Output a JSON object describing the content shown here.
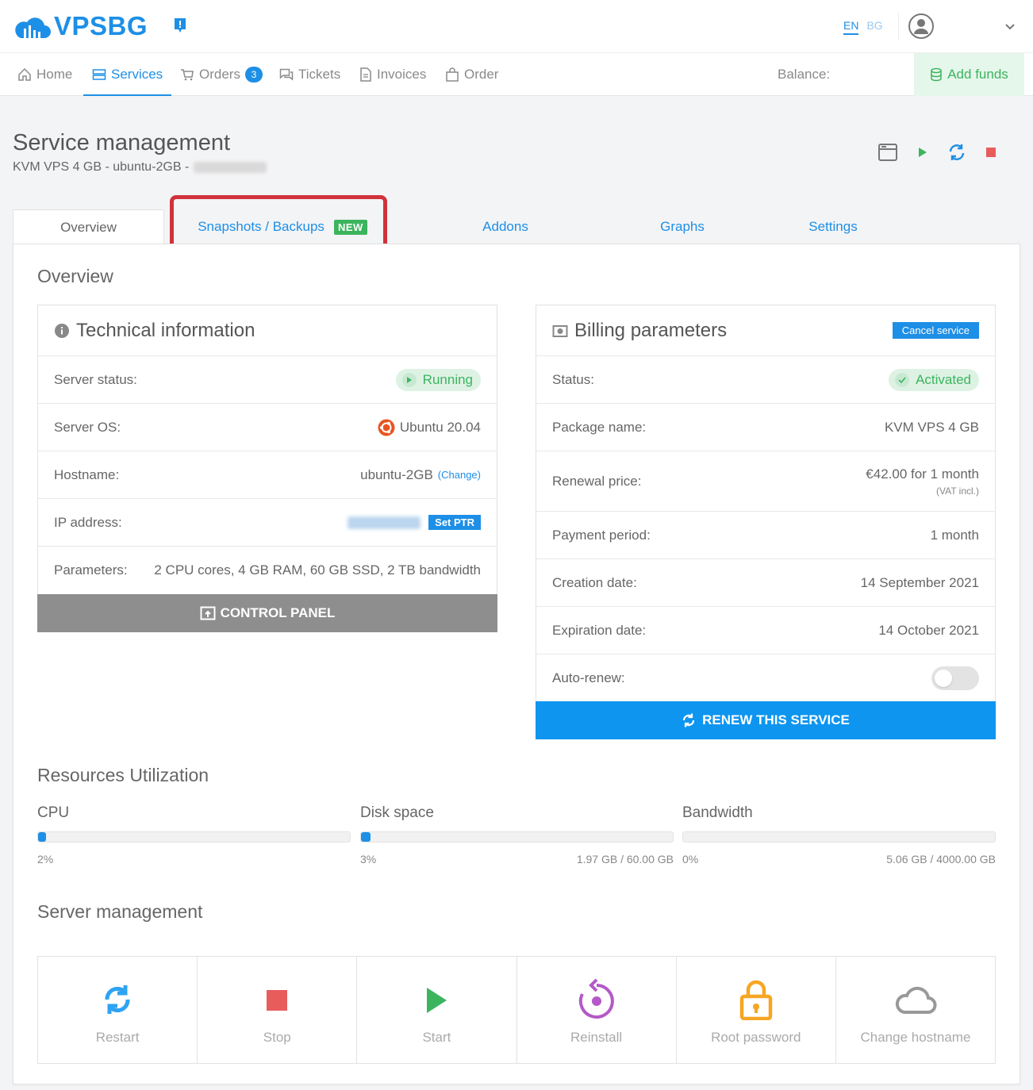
{
  "header": {
    "logo_text": "VPSBG",
    "lang_en": "EN",
    "lang_bg": "BG"
  },
  "nav": {
    "home": "Home",
    "services": "Services",
    "orders": "Orders",
    "orders_count": "3",
    "tickets": "Tickets",
    "invoices": "Invoices",
    "order": "Order",
    "balance": "Balance:",
    "add_funds": "Add funds"
  },
  "page": {
    "title": "Service management",
    "subtitle": "KVM VPS 4 GB - ubuntu-2GB -"
  },
  "tabs": {
    "overview": "Overview",
    "snapshots": "Snapshots / Backups",
    "new_badge": "NEW",
    "addons": "Addons",
    "graphs": "Graphs",
    "settings": "Settings"
  },
  "overview": {
    "title": "Overview"
  },
  "technical": {
    "title": "Technical information",
    "rows": {
      "status_label": "Server status:",
      "status_value": "Running",
      "os_label": "Server OS:",
      "os_value": "Ubuntu 20.04",
      "hostname_label": "Hostname:",
      "hostname_value": "ubuntu-2GB",
      "hostname_change": "(Change)",
      "ip_label": "IP address:",
      "set_ptr": "Set PTR",
      "params_label": "Parameters:",
      "params_value": "2 CPU cores, 4 GB RAM, 60 GB SSD, 2 TB bandwidth"
    },
    "control_panel": "CONTROL PANEL"
  },
  "billing": {
    "title": "Billing parameters",
    "cancel": "Cancel service",
    "rows": {
      "status_label": "Status:",
      "status_value": "Activated",
      "package_label": "Package name:",
      "package_value": "KVM VPS 4 GB",
      "renewal_label": "Renewal price:",
      "renewal_value": "€42.00 for 1 month",
      "renewal_vat": "(VAT incl.)",
      "period_label": "Payment period:",
      "period_value": "1 month",
      "created_label": "Creation date:",
      "created_value": "14 September 2021",
      "expires_label": "Expiration date:",
      "expires_value": "14 October 2021",
      "autorenew_label": "Auto-renew:"
    },
    "autorenew_on": false,
    "renew": "RENEW THIS SERVICE"
  },
  "resources": {
    "title": "Resources Utilization",
    "cpu_label": "CPU",
    "cpu_percent": "2%",
    "cpu_fraction": 0.02,
    "disk_label": "Disk space",
    "disk_percent": "3%",
    "disk_fraction": 0.03,
    "disk_usage": "1.97 GB / 60.00 GB",
    "bw_label": "Bandwidth",
    "bw_percent": "0%",
    "bw_fraction": 0.0,
    "bw_usage": "5.06 GB / 4000.00 GB"
  },
  "server_mgmt": {
    "title": "Server management",
    "restart": "Restart",
    "stop": "Stop",
    "start": "Start",
    "reinstall": "Reinstall",
    "root_password": "Root password",
    "change_hostname": "Change hostname"
  },
  "colors": {
    "accent": "#1e8fe6",
    "success": "#3cb45e",
    "danger": "#e85c5c",
    "highlight_border": "#d1323a",
    "reinstall": "#b459c8",
    "root_password": "#f6a623"
  }
}
